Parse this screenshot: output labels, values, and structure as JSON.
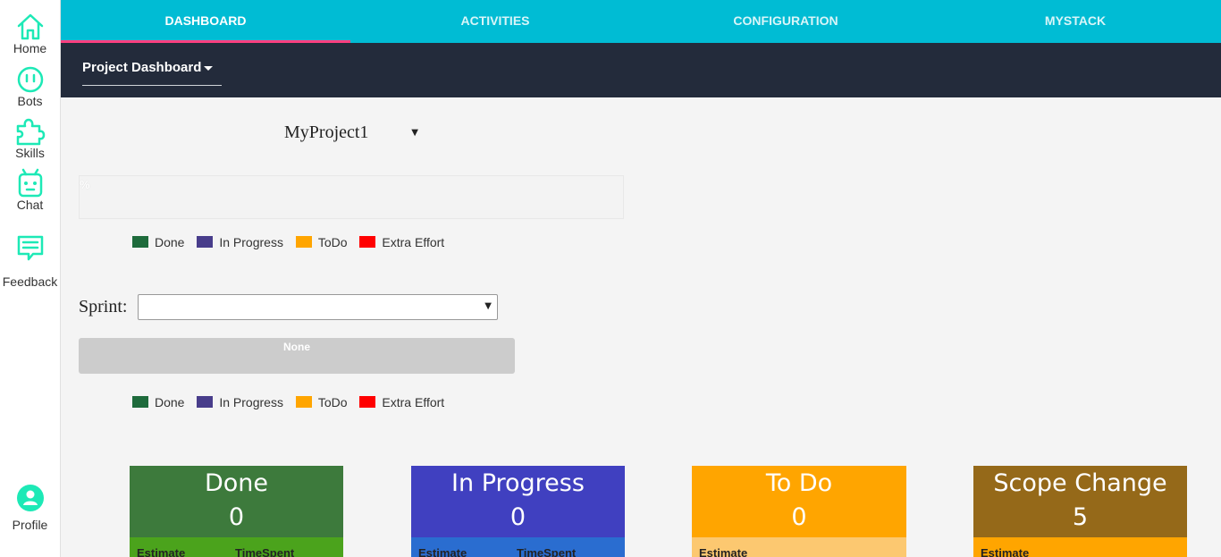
{
  "sidebar": {
    "items": [
      {
        "label": "Home",
        "icon": "home-icon"
      },
      {
        "label": "Bots",
        "icon": "bot-icon"
      },
      {
        "label": "Skills",
        "icon": "puzzle-icon"
      },
      {
        "label": "Chat",
        "icon": "robot-icon"
      },
      {
        "label": "Feedback",
        "icon": "feedback-icon"
      }
    ],
    "profile": {
      "label": "Profile",
      "icon": "profile-icon"
    },
    "accent": "#1de9b6"
  },
  "tabs": [
    {
      "label": "DASHBOARD",
      "active": true
    },
    {
      "label": "ACTIVITIES",
      "active": false
    },
    {
      "label": "CONFIGURATION",
      "active": false
    },
    {
      "label": "MYSTACK",
      "active": false
    }
  ],
  "subbar": {
    "dashboard_select": "Project Dashboard"
  },
  "project": {
    "selected": "MyProject1",
    "arrow": "▼"
  },
  "progress": {
    "percent_label": "%"
  },
  "legend": [
    {
      "label": "Done",
      "color": "#1e6b3c"
    },
    {
      "label": "In Progress",
      "color": "#483d8b"
    },
    {
      "label": "ToDo",
      "color": "#ffa500"
    },
    {
      "label": "Extra Effort",
      "color": "#ff0000"
    }
  ],
  "sprint": {
    "label": "Sprint:",
    "value": "",
    "arrow": "▼",
    "none_label": "None"
  },
  "cards": [
    {
      "title": "Done",
      "value": "0",
      "head_color": "#3d7a3c",
      "foot_color": "#4ba31c",
      "foot_labels": [
        "Estimate",
        "TimeSpent"
      ]
    },
    {
      "title": "In Progress",
      "value": "0",
      "head_color": "#4040c0",
      "foot_color": "#2a6dd0",
      "foot_labels": [
        "Estimate",
        "TimeSpent"
      ]
    },
    {
      "title": "To Do",
      "value": "0",
      "head_color": "#ffa500",
      "foot_color": "#fcc870",
      "foot_labels": [
        "Estimate"
      ]
    },
    {
      "title": "Scope Change",
      "value": "5",
      "head_color": "#956919",
      "foot_color": "#ffa500",
      "foot_labels": [
        "Estimate"
      ]
    }
  ]
}
